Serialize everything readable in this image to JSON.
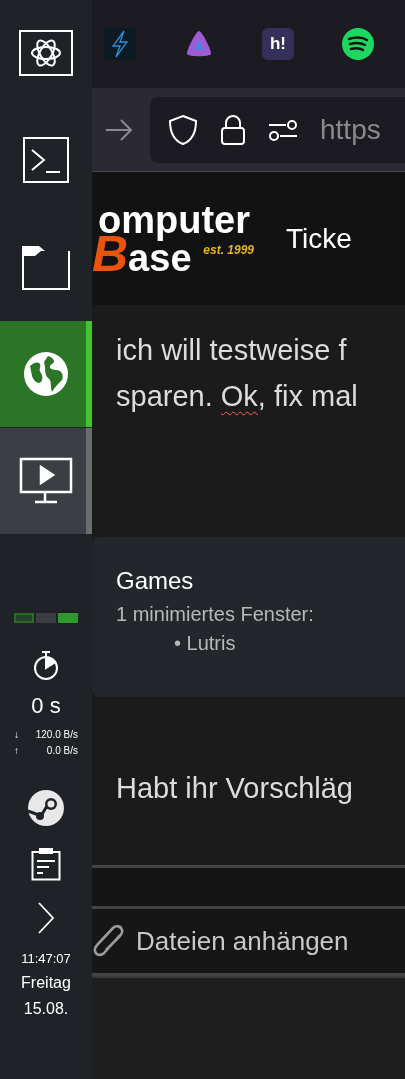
{
  "panel": {
    "launchers": [
      {
        "kind": "atom",
        "selected": false,
        "minimized": false
      },
      {
        "kind": "terminal",
        "selected": false,
        "minimized": false
      },
      {
        "kind": "folder",
        "selected": false,
        "minimized": false
      },
      {
        "kind": "globe",
        "selected": true,
        "minimized": false
      },
      {
        "kind": "monitor",
        "selected": false,
        "minimized": true
      }
    ],
    "pager": [
      {
        "selected": false,
        "occupied": true
      },
      {
        "selected": false,
        "occupied": false
      },
      {
        "selected": true,
        "occupied": true
      }
    ],
    "timer": "0 s",
    "network": {
      "down_arrow": "↓",
      "down": "120.0 B/s",
      "up_arrow": "↑",
      "up": "0.0 B/s"
    },
    "tray": [
      {
        "kind": "steam"
      },
      {
        "kind": "clipboard"
      },
      {
        "kind": "expand"
      }
    ],
    "clock": {
      "time": "11:47:07",
      "day": "Freitag",
      "date": "15.08."
    }
  },
  "browser": {
    "bookmarks": [
      {
        "kind": "bolt"
      },
      {
        "kind": "triangle"
      },
      {
        "kind": "tile",
        "label": "h!"
      },
      {
        "kind": "waves"
      }
    ],
    "url": "https",
    "site": {
      "logo": {
        "line1": "omputer",
        "initial": "B",
        "line2": "ase",
        "est": "est. 1999"
      },
      "nav": "Ticke"
    },
    "post": {
      "lines": [
        [
          {
            "text": "ich will testweise f"
          }
        ],
        [
          {
            "text": "sparen. "
          },
          {
            "text": "Ok",
            "misspelled": true
          },
          {
            "text": ", fix mal"
          }
        ],
        [
          {
            "text": "Habt ihr Vorschläg"
          }
        ]
      ]
    },
    "editor": {
      "attach": "Dateien anhängen"
    }
  },
  "tooltip": {
    "title": "Games",
    "subtitle": "1 minimiertes Fenster:",
    "windows": [
      "• Lutris"
    ]
  }
}
